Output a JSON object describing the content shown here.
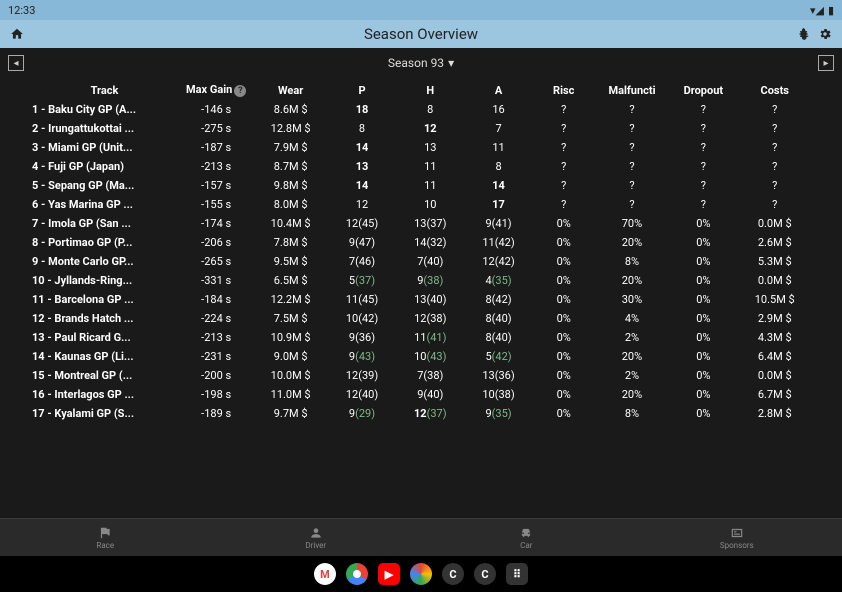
{
  "status": {
    "time": "12:33"
  },
  "header": {
    "title": "Season Overview"
  },
  "season": {
    "label": "Season 93"
  },
  "columns": [
    "Track",
    "Max Gain",
    "Wear",
    "P",
    "H",
    "A",
    "Risc",
    "Malfuncti",
    "Dropout",
    "Costs"
  ],
  "rows": [
    {
      "track": "1 - Baku City GP (A...",
      "gain": "-146 s",
      "wear": "8.6M $",
      "p": "18",
      "pb": true,
      "h": "8",
      "a": "16",
      "risc": "?",
      "mal": "?",
      "drop": "?",
      "cost": "?"
    },
    {
      "track": "2 - Irungattukottai ...",
      "gain": "-275 s",
      "wear": "12.8M $",
      "p": "8",
      "h": "12",
      "hb": true,
      "a": "7",
      "risc": "?",
      "mal": "?",
      "drop": "?",
      "cost": "?"
    },
    {
      "track": "3 - Miami GP (Unit...",
      "gain": "-187 s",
      "wear": "7.9M $",
      "p": "14",
      "pb": true,
      "h": "13",
      "a": "11",
      "risc": "?",
      "mal": "?",
      "drop": "?",
      "cost": "?"
    },
    {
      "track": "4 - Fuji GP (Japan)",
      "gain": "-213 s",
      "wear": "8.7M $",
      "p": "13",
      "pb": true,
      "h": "11",
      "a": "8",
      "risc": "?",
      "mal": "?",
      "drop": "?",
      "cost": "?"
    },
    {
      "track": "5 - Sepang GP (Ma...",
      "gain": "-157 s",
      "wear": "9.8M $",
      "p": "14",
      "pb": true,
      "h": "11",
      "a": "14",
      "ab": true,
      "risc": "?",
      "mal": "?",
      "drop": "?",
      "cost": "?"
    },
    {
      "track": "6 - Yas Marina GP ...",
      "gain": "-155 s",
      "wear": "8.0M $",
      "p": "12",
      "h": "10",
      "a": "17",
      "ab": true,
      "risc": "?",
      "mal": "?",
      "drop": "?",
      "cost": "?"
    },
    {
      "track": "7 - Imola GP (San ...",
      "gain": "-174 s",
      "wear": "10.4M $",
      "p": "12(45)",
      "h": "13(37)",
      "a": "9(41)",
      "risc": "0%",
      "mal": "70%",
      "drop": "0%",
      "cost": "0.0M $"
    },
    {
      "track": "8 - Portimao GP (P...",
      "gain": "-206 s",
      "wear": "7.8M $",
      "p": "9(47)",
      "h": "14(32)",
      "a": "11(42)",
      "risc": "0%",
      "mal": "20%",
      "drop": "0%",
      "cost": "2.6M $"
    },
    {
      "track": "9 - Monte Carlo GP...",
      "gain": "-265 s",
      "wear": "9.5M $",
      "p": "7(46)",
      "h": "7(40)",
      "a": "12(42)",
      "risc": "0%",
      "mal": "8%",
      "drop": "0%",
      "cost": "5.3M $"
    },
    {
      "track": "10 - Jyllands-Ring...",
      "gain": "-331 s",
      "wear": "6.5M $",
      "p": "5",
      "pp": "(37)",
      "pg": true,
      "h": "9",
      "hp": "(38)",
      "hg": true,
      "a": "4",
      "ap": "(35)",
      "ag": true,
      "risc": "0%",
      "mal": "20%",
      "drop": "0%",
      "cost": "0.0M $"
    },
    {
      "track": "11 - Barcelona GP ...",
      "gain": "-184 s",
      "wear": "12.2M $",
      "p": "11(45)",
      "h": "13(40)",
      "a": "8(42)",
      "risc": "0%",
      "mal": "30%",
      "drop": "0%",
      "cost": "10.5M $"
    },
    {
      "track": "12 - Brands Hatch ...",
      "gain": "-224 s",
      "wear": "7.5M $",
      "p": "10(42)",
      "h": "12(38)",
      "a": "8(40)",
      "risc": "0%",
      "mal": "4%",
      "drop": "0%",
      "cost": "2.9M $"
    },
    {
      "track": "13 - Paul Ricard G...",
      "gain": "-213 s",
      "wear": "10.9M $",
      "p": "9(36)",
      "h": "11",
      "hp": "(41)",
      "hg": true,
      "a": "8(40)",
      "risc": "0%",
      "mal": "2%",
      "drop": "0%",
      "cost": "4.3M $"
    },
    {
      "track": "14 - Kaunas GP (Li...",
      "gain": "-231 s",
      "wear": "9.0M $",
      "p": "9",
      "pp": "(43)",
      "pg": true,
      "h": "10",
      "hp": "(43)",
      "hg": true,
      "a": "5",
      "ap": "(42)",
      "ag": true,
      "risc": "0%",
      "mal": "20%",
      "drop": "0%",
      "cost": "6.4M $"
    },
    {
      "track": "15 - Montreal GP (...",
      "gain": "-200 s",
      "wear": "10.0M $",
      "p": "12(39)",
      "h": "7(38)",
      "a": "13(36)",
      "risc": "0%",
      "mal": "2%",
      "drop": "0%",
      "cost": "0.0M $"
    },
    {
      "track": "16 - Interlagos GP ...",
      "gain": "-198 s",
      "wear": "11.0M $",
      "p": "12(40)",
      "h": "9(40)",
      "a": "10(38)",
      "risc": "0%",
      "mal": "20%",
      "drop": "0%",
      "cost": "6.7M $"
    },
    {
      "track": "17 - Kyalami GP (S...",
      "gain": "-189 s",
      "wear": "9.7M $",
      "p": "9",
      "pp": "(29)",
      "pg": true,
      "h": "12",
      "hb": true,
      "hp": "(37)",
      "hg": true,
      "a": "9",
      "ap": "(35)",
      "ag": true,
      "risc": "0%",
      "mal": "8%",
      "drop": "0%",
      "cost": "2.8M $"
    }
  ],
  "nav": {
    "race": "Race",
    "driver": "Driver",
    "car": "Car",
    "sponsors": "Sponsors"
  }
}
